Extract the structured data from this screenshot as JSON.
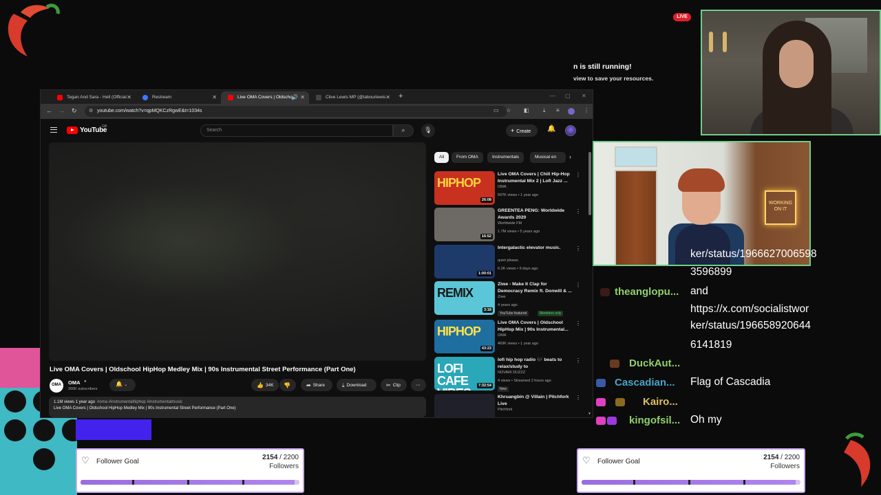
{
  "browser": {
    "tabs": [
      {
        "label": "Tegan And Sara - Hell (Official",
        "active": false,
        "favicon_color": "#ff0000"
      },
      {
        "label": "Restream",
        "active": false,
        "favicon_color": "#3b7bff"
      },
      {
        "label": "Live OMA Covers | Oldscho",
        "active": true,
        "favicon_color": "#ff0000"
      },
      {
        "label": "Clive Lewis MP (@labourlewis",
        "active": false,
        "favicon_color": "#444444"
      }
    ],
    "url": "youtube.com/watch?v=qpMQKCzRgwE&t=1034s"
  },
  "youtube": {
    "wordmark": "YouTube",
    "region": "GB",
    "search_placeholder": "Search",
    "create_label": "Create",
    "video_title": "Live OMA Covers | Oldschool HipHop Medley Mix | 90s Instrumental Street Performance (Part One)",
    "channel": {
      "name": "OMA",
      "subscribers": "260K subscribers",
      "avatar_text": "OMA"
    },
    "actions": {
      "likes": "34K",
      "share": "Share",
      "download": "Download",
      "clip": "Clip"
    },
    "description": {
      "meta": "1.1M views  1 year ago",
      "tags": "#oma #instrumentalhiphop #instrumentalmusic",
      "line": "Live OMA Covers | Oldschool HipHop Medley Mix | 90s Instrumental Street Performance (Part One)"
    },
    "chips": [
      "All",
      "From OMA",
      "Instrumentals",
      "Musical en"
    ],
    "recommendations": [
      {
        "title": "Live OMA Covers | Chill Hip-Hop Instrumental Mix 2 | Lofi Jazz ...",
        "channel": "OMA",
        "meta": "597K views • 1 year ago",
        "duration": "26:08",
        "thumb_text": "HIPHOP",
        "thumb_bg": "#c8301f",
        "thumb_fg": "#ffd23f"
      },
      {
        "title": "GREENTEA PENG: Worldwide Awards 2020",
        "channel": "Worldwide FM",
        "meta": "1.7M views • 5 years ago",
        "duration": "16:52",
        "thumb_text": "",
        "thumb_bg": "#6d6a66",
        "thumb_fg": "#ffffff"
      },
      {
        "title": "Intergalactic elevator music.",
        "channel": "quiet please.",
        "meta": "6.2K views • 9 days ago",
        "duration": "1:00:01",
        "thumb_text": "",
        "thumb_bg": "#1d3a6b",
        "thumb_fg": "#4fd36b"
      },
      {
        "title": "Ziwe - Make It Clap for Democracy Remix ft. Donwill & ...",
        "channel": "Ziwe",
        "meta": "4 years ago",
        "duration": "3:18",
        "thumb_text": "REMIX",
        "thumb_bg": "#5bc6d8",
        "thumb_fg": "#1a1a1a",
        "badge": "YouTube featured",
        "badge2": "Members only"
      },
      {
        "title": "Live OMA Covers | Oldschool HipHop Mix | 90s Instrumental...",
        "channel": "OMA",
        "meta": "469K views • 1 year ago",
        "duration": "43:23",
        "thumb_text": "HIPHOP",
        "thumb_bg": "#1f6ea0",
        "thumb_fg": "#ffe14a"
      },
      {
        "title": "lofi hip hop radio 🎶 beats to relax/study to",
        "channel": "NOVARI DUZZZ",
        "meta": "4 views • Streamed 2 hours ago",
        "duration": "7:32:54",
        "thumb_text": "LOFI CAFE VIBES",
        "thumb_bg": "#2aa7b8",
        "thumb_fg": "#ffffff",
        "badge": "New"
      },
      {
        "title": "Khruangbin @ Villain | Pitchfork Live",
        "channel": "Pitchfork",
        "meta": "",
        "duration": "",
        "thumb_text": "",
        "thumb_bg": "#20202a",
        "thumb_fg": "#ffffff"
      }
    ]
  },
  "overlay": {
    "notification_line1": "n is still running!",
    "notification_line2": "view to save your resources.",
    "live_badge": "LIVE",
    "neon_sign": "WORKING ON IT",
    "chat": [
      {
        "name": "",
        "message": "ker/status/1966627006598"
      },
      {
        "name": "",
        "message": "3596899"
      },
      {
        "name": "theanglopu...",
        "message": "and",
        "color": "#8fd16a"
      },
      {
        "name": "",
        "message": "https://x.com/socialistwor"
      },
      {
        "name": "",
        "message": "ker/status/196658920644"
      },
      {
        "name": "",
        "message": "6141819"
      },
      {
        "name": "DuckAut...",
        "message": "",
        "color": "#8fd16a"
      },
      {
        "name": "Cascadian...",
        "message": "Flag of Cascadia",
        "color": "#4aa3c9"
      },
      {
        "name": "Kairo...",
        "message": "",
        "color": "#e0c060"
      },
      {
        "name": "kingofsil...",
        "message": "Oh my",
        "color": "#8fd16a"
      }
    ],
    "follower_goals": [
      {
        "title": "Follower Goal",
        "current": "2154",
        "separator": " / ",
        "target": "2200",
        "unit": "Followers",
        "progress": 0.979
      },
      {
        "title": "Follower Goal",
        "current": "2154",
        "separator": " / ",
        "target": "2200",
        "unit": "Followers",
        "progress": 0.979
      }
    ]
  },
  "colors": {
    "accent_green": "#6ecf8a",
    "youtube_red": "#ff0000",
    "goal_purple": "#b085ee",
    "live_red": "#e01f2b"
  }
}
